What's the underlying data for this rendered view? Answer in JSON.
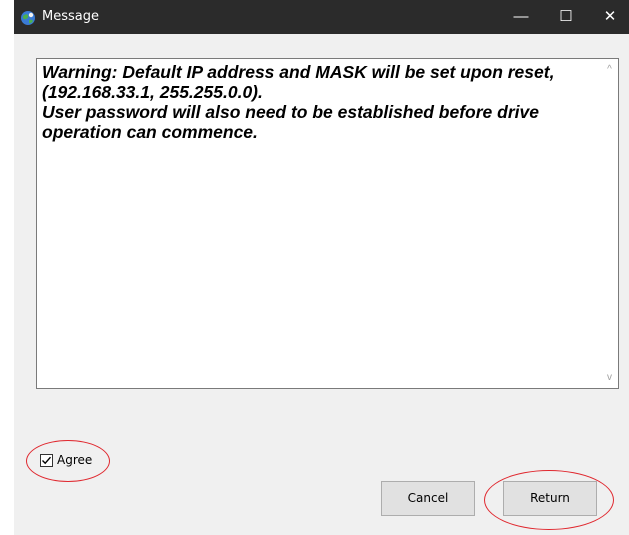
{
  "window": {
    "title": "Message",
    "minimize_glyph": "—",
    "maximize_glyph": "☐",
    "close_glyph": "✕"
  },
  "message": {
    "text": "Warning: Default IP address and MASK will be set upon reset,\n(192.168.33.1, 255.255.0.0).\nUser password will also need to be established before drive\noperation can commence."
  },
  "scrollbar": {
    "up_glyph": "^",
    "down_glyph": "v"
  },
  "agree": {
    "label": "Agree",
    "checked": true
  },
  "buttons": {
    "cancel_label": "Cancel",
    "return_label": "Return"
  },
  "colors": {
    "titlebar": "#2b2b2b",
    "annotation": "#e0282f"
  }
}
